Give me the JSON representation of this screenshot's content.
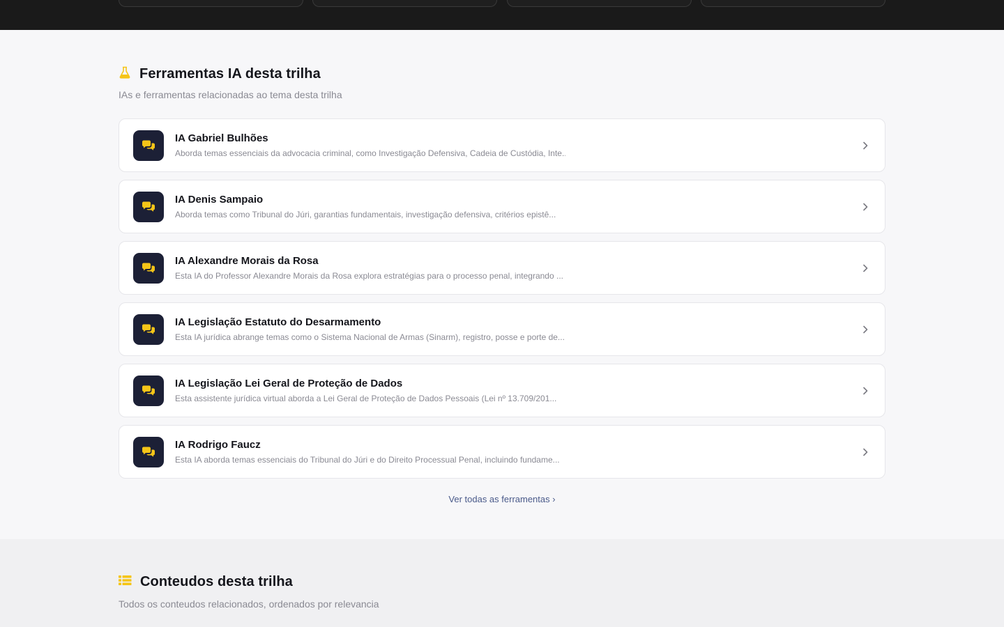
{
  "tools_section": {
    "title": "Ferramentas IA desta trilha",
    "subtitle": "IAs e ferramentas relacionadas ao tema desta trilha",
    "icon": "flask-icon",
    "accent_color": "#f5c518",
    "items": [
      {
        "name": "IA Gabriel Bulhões",
        "description": "Aborda temas essenciais da advocacia criminal, como Investigação Defensiva, Cadeia de Custódia, Inte...",
        "icon": "chat-bubbles-icon"
      },
      {
        "name": "IA Denis Sampaio",
        "description": "Aborda temas como Tribunal do Júri, garantias fundamentais, investigação defensiva, critérios epistê...",
        "icon": "chat-bubbles-icon"
      },
      {
        "name": "IA Alexandre Morais da Rosa",
        "description": "Esta IA do Professor Alexandre Morais da Rosa explora estratégias para o processo penal, integrando ...",
        "icon": "chat-bubbles-icon"
      },
      {
        "name": "IA Legislação Estatuto do Desarmamento",
        "description": "Esta IA jurídica abrange temas como o Sistema Nacional de Armas (Sinarm), registro, posse e porte de...",
        "icon": "chat-bubbles-icon"
      },
      {
        "name": "IA Legislação Lei Geral de Proteção de Dados",
        "description": "Esta assistente jurídica virtual aborda a Lei Geral de Proteção de Dados Pessoais (Lei nº 13.709/201...",
        "icon": "chat-bubbles-icon"
      },
      {
        "name": "IA Rodrigo Faucz",
        "description": "Esta IA aborda temas essenciais do Tribunal do Júri e do Direito Processual Penal, incluindo fundame...",
        "icon": "chat-bubbles-icon"
      }
    ],
    "see_all_label": "Ver todas as ferramentas",
    "see_all_chevron": "›"
  },
  "contents_section": {
    "title": "Conteudos desta trilha",
    "subtitle": "Todos os conteudos relacionados, ordenados por relevancia",
    "icon": "list-icon"
  }
}
